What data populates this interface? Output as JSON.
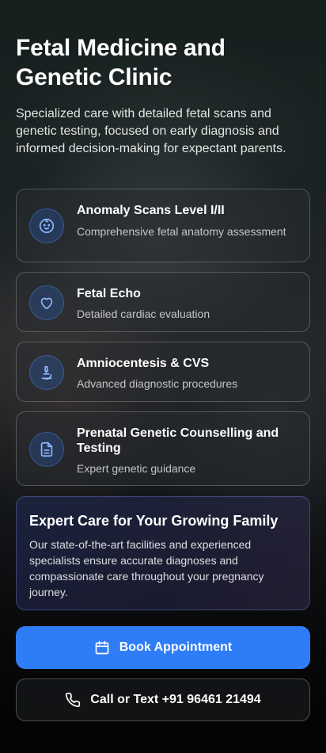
{
  "hero": {
    "title": "Fetal Medicine and Genetic Clinic",
    "subtitle": "Specialized care with detailed fetal scans and genetic testing, focused on early diagnosis and informed decision-making for expectant parents."
  },
  "services": [
    {
      "icon": "baby-face-icon",
      "title": "Anomaly Scans Level I/II",
      "description": "Comprehensive fetal anatomy assessment"
    },
    {
      "icon": "heart-icon",
      "title": "Fetal Echo",
      "description": "Detailed cardiac evaluation"
    },
    {
      "icon": "microscope-icon",
      "title": "Amniocentesis & CVS",
      "description": "Advanced diagnostic procedures"
    },
    {
      "icon": "document-icon",
      "title": "Prenatal Genetic Counselling and Testing",
      "description": "Expert genetic guidance"
    }
  ],
  "promo": {
    "title": "Expert Care for Your Growing Family",
    "text": "Our state-of-the-art facilities and experienced specialists ensure accurate diagnoses and compassionate care throughout your pregnancy journey."
  },
  "actions": {
    "book_label": "Book Appointment",
    "call_label": "Call or Text +91 96461 21494"
  },
  "colors": {
    "accent": "#2f7df6",
    "icon_blue": "#8fb8ff"
  }
}
